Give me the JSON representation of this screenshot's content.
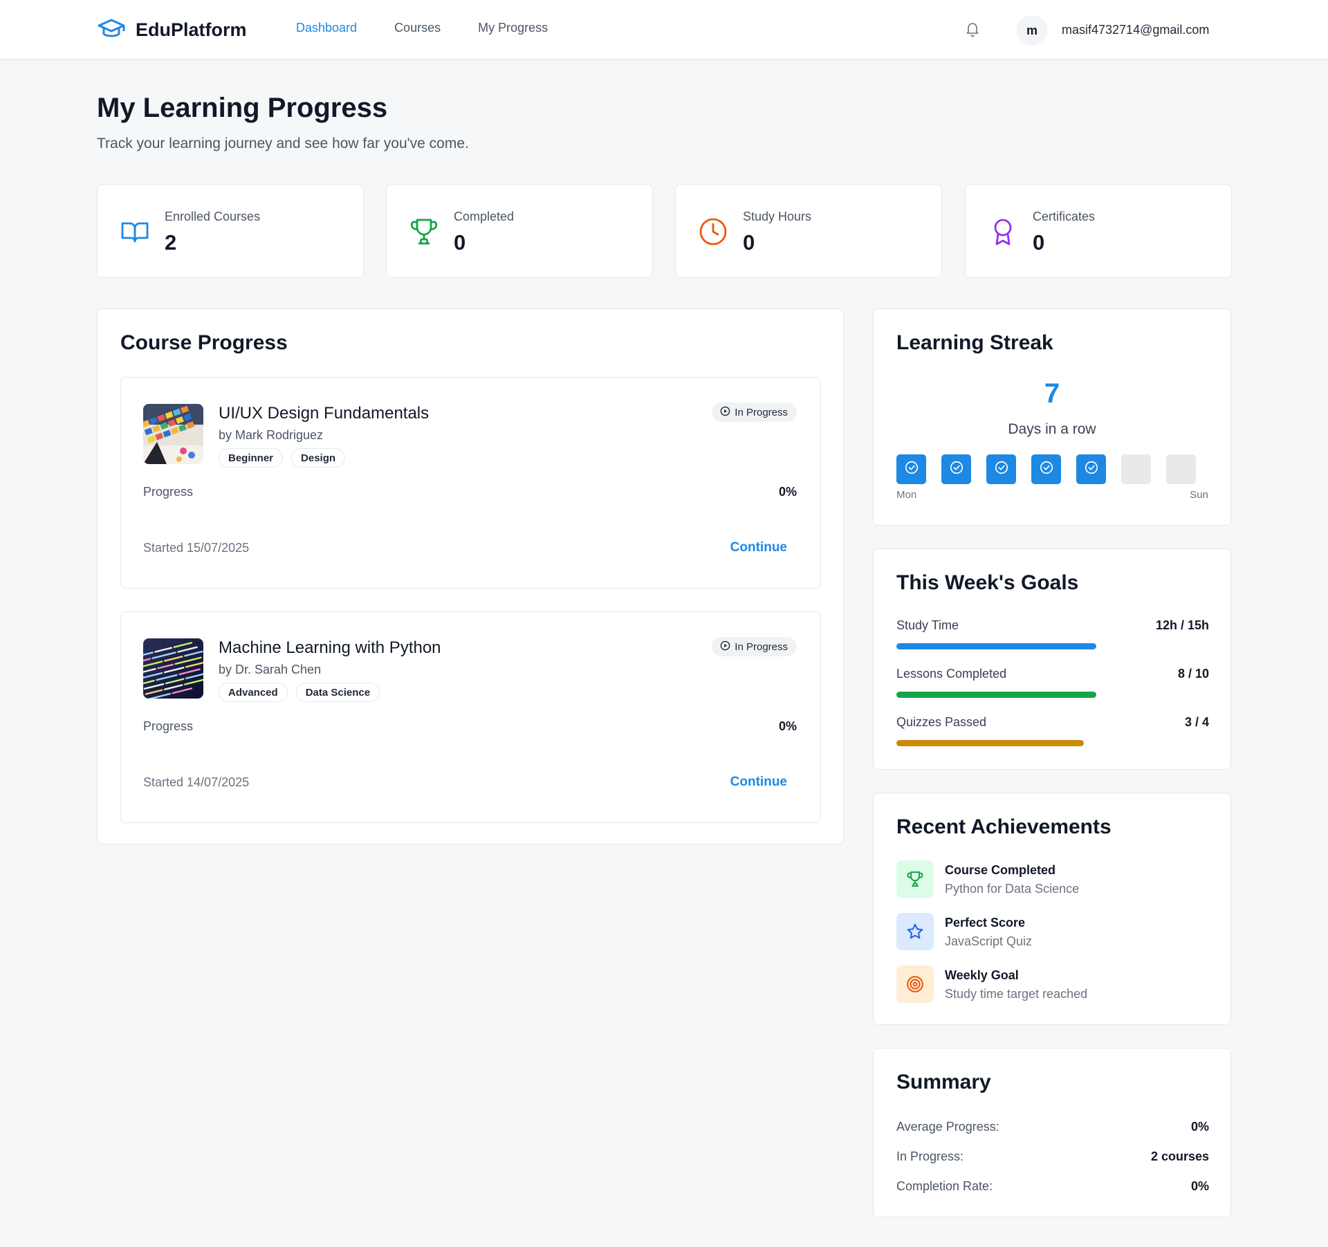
{
  "header": {
    "brand": "EduPlatform",
    "nav": [
      "Dashboard",
      "Courses",
      "My Progress"
    ],
    "active_nav": "Dashboard",
    "avatar_initial": "m",
    "user_email": "masif4732714@gmail.com"
  },
  "page": {
    "title": "My Learning Progress",
    "subtitle": "Track your learning journey and see how far you've come."
  },
  "stats": [
    {
      "label": "Enrolled Courses",
      "value": "2",
      "icon": "book-open-icon",
      "color": "#1e88e5"
    },
    {
      "label": "Completed",
      "value": "0",
      "icon": "trophy-icon",
      "color": "#16a34a"
    },
    {
      "label": "Study Hours",
      "value": "0",
      "icon": "clock-icon",
      "color": "#ea580c"
    },
    {
      "label": "Certificates",
      "value": "0",
      "icon": "award-icon",
      "color": "#9333ea"
    }
  ],
  "course_progress": {
    "title": "Course Progress",
    "courses": [
      {
        "title": "UI/UX Design Fundamentals",
        "author": "by Mark Rodriguez",
        "tags": [
          "Beginner",
          "Design"
        ],
        "status": "In Progress",
        "progress_label": "Progress",
        "progress_value": "0%",
        "started": "Started 15/07/2025",
        "action": "Continue"
      },
      {
        "title": "Machine Learning with Python",
        "author": "by Dr. Sarah Chen",
        "tags": [
          "Advanced",
          "Data Science"
        ],
        "status": "In Progress",
        "progress_label": "Progress",
        "progress_value": "0%",
        "started": "Started 14/07/2025",
        "action": "Continue"
      }
    ]
  },
  "streak": {
    "title": "Learning Streak",
    "count": "7",
    "label": "Days in a row",
    "days_active": [
      true,
      true,
      true,
      true,
      true,
      false,
      false
    ],
    "start_label": "Mon",
    "end_label": "Sun"
  },
  "goals": {
    "title": "This Week's Goals",
    "items": [
      {
        "label": "Study Time",
        "value": "12h / 15h",
        "fraction": 0.8,
        "color": "#1e88e5"
      },
      {
        "label": "Lessons Completed",
        "value": "8 / 10",
        "fraction": 0.8,
        "color": "#16a34a"
      },
      {
        "label": "Quizzes Passed",
        "value": "3 / 4",
        "fraction": 0.75,
        "color": "#ca8a04"
      }
    ]
  },
  "achievements": {
    "title": "Recent Achievements",
    "items": [
      {
        "title": "Course Completed",
        "subtitle": "Python for Data Science",
        "icon": "trophy-icon",
        "bg": "#dcfce7",
        "color": "#16a34a"
      },
      {
        "title": "Perfect Score",
        "subtitle": "JavaScript Quiz",
        "icon": "star-icon",
        "bg": "#dbeafe",
        "color": "#2563eb"
      },
      {
        "title": "Weekly Goal",
        "subtitle": "Study time target reached",
        "icon": "target-icon",
        "bg": "#ffedd5",
        "color": "#ea580c"
      }
    ]
  },
  "summary": {
    "title": "Summary",
    "rows": [
      {
        "label": "Average Progress:",
        "value": "0%"
      },
      {
        "label": "In Progress:",
        "value": "2 courses"
      },
      {
        "label": "Completion Rate:",
        "value": "0%"
      }
    ]
  }
}
